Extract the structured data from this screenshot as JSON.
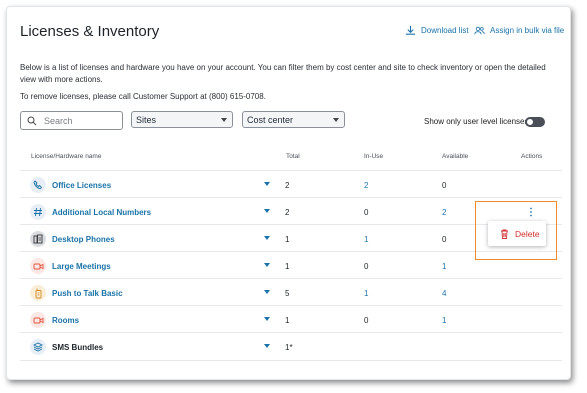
{
  "page": {
    "title": "Licenses & Inventory",
    "download_label": "Download list",
    "assign_label": "Assign in bulk via file",
    "description": "Below is a list of licenses and hardware you have on your account. You can filter them by cost center and site to check inventory or open the detailed view with more actions.",
    "support_note": "To remove licenses, please call Customer Support at (800) 615-0708."
  },
  "filters": {
    "search_placeholder": "Search",
    "sites_label": "Sites",
    "cost_center_label": "Cost center",
    "toggle_label": "Show only user level licenses"
  },
  "table": {
    "headers": {
      "name": "License/Hardware name",
      "total": "Total",
      "in_use": "In-Use",
      "available": "Available",
      "actions": "Actions"
    },
    "rows": [
      {
        "name": "Office Licenses",
        "total": "2",
        "in_use": "2",
        "available": "0",
        "icon": "phone-icon",
        "color": "#1a73a8"
      },
      {
        "name": "Additional Local Numbers",
        "total": "2",
        "in_use": "0",
        "available": "2",
        "icon": "hash-icon",
        "color": "#1a73a8"
      },
      {
        "name": "Desktop Phones",
        "total": "1",
        "in_use": "1",
        "available": "0",
        "icon": "desk-phone-icon",
        "color": "#1a73a8"
      },
      {
        "name": "Large Meetings",
        "total": "1",
        "in_use": "0",
        "available": "1",
        "icon": "video-icon",
        "color": "#1a73a8"
      },
      {
        "name": "Push to Talk Basic",
        "total": "5",
        "in_use": "1",
        "available": "4",
        "icon": "walkie-talkie-icon",
        "color": "#1a73a8"
      },
      {
        "name": "Rooms",
        "total": "1",
        "in_use": "0",
        "available": "1",
        "icon": "video-icon",
        "color": "#1a73a8"
      },
      {
        "name": "SMS Bundles",
        "total": "1*",
        "in_use": "",
        "available": "",
        "icon": "layers-icon",
        "color": "#1e2329"
      }
    ]
  },
  "menu": {
    "delete_label": "Delete"
  },
  "colors": {
    "accent": "#1a73a8",
    "danger": "#d22f2f",
    "highlight": "#f08a2c"
  }
}
